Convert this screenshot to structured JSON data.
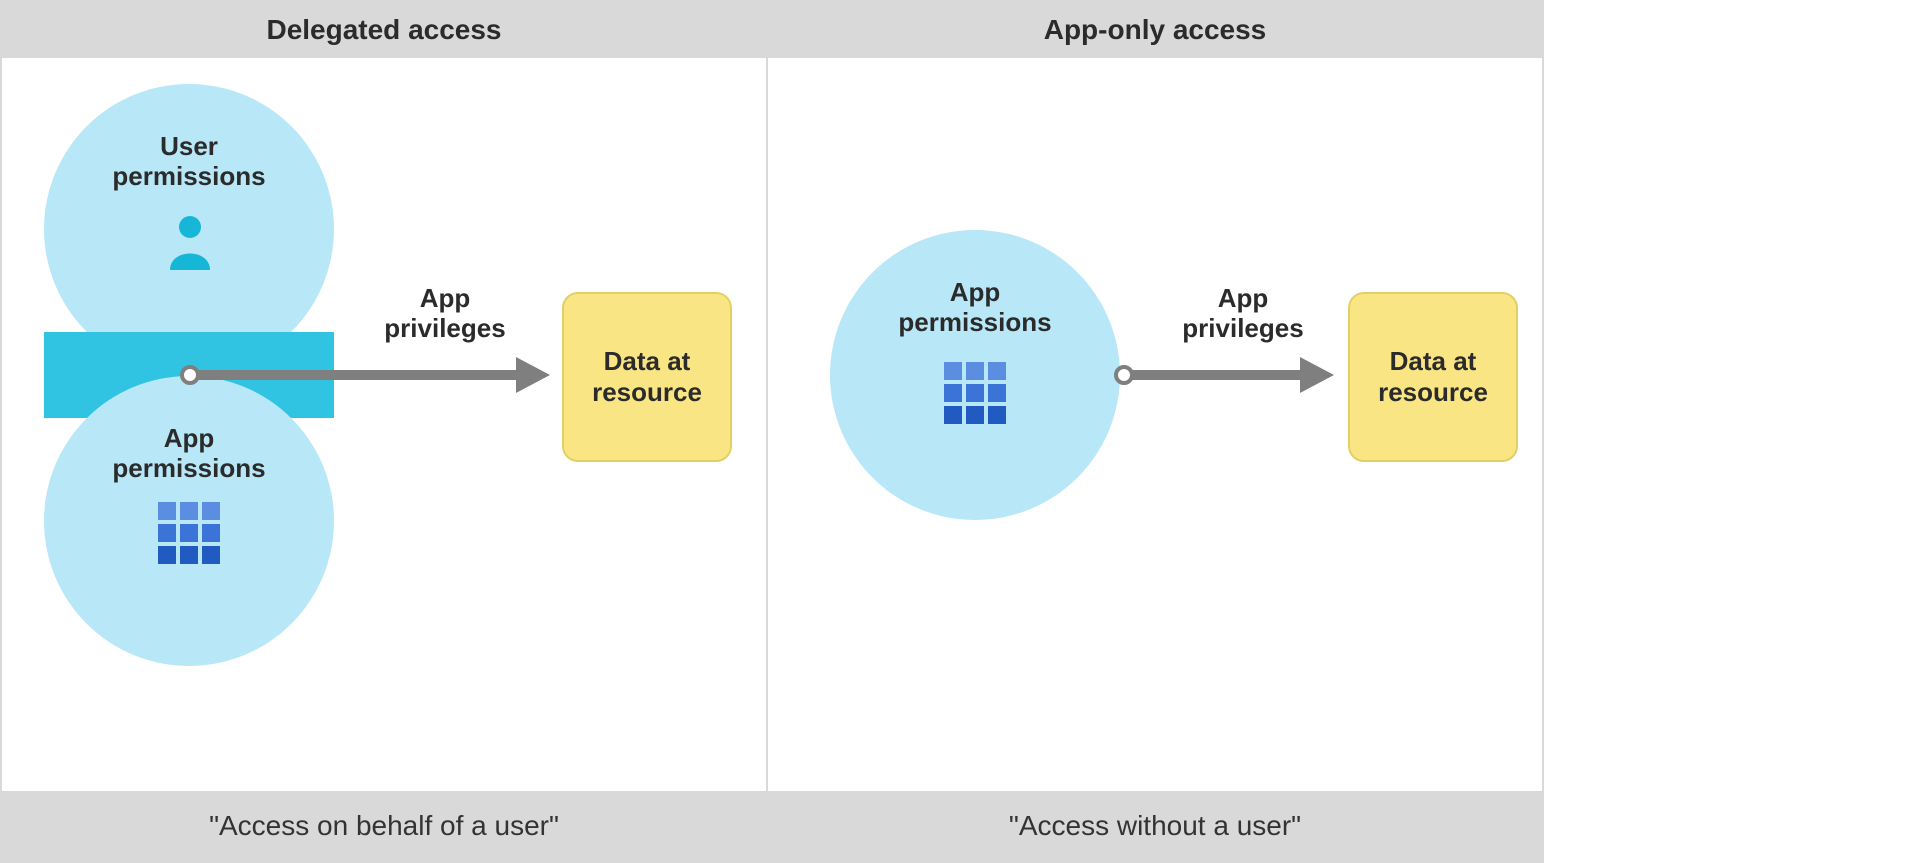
{
  "left": {
    "title": "Delegated access",
    "footer": "\"Access on behalf of a user\"",
    "user_perm_label": "User\npermissions",
    "app_perm_label": "App\npermissions",
    "arrow_label": "App\nprivileges",
    "resource_label": "Data at\nresource"
  },
  "right": {
    "title": "App-only access",
    "footer": "\"Access without a user\"",
    "app_perm_label": "App\npermissions",
    "arrow_label": "App\nprivileges",
    "resource_label": "Data at\nresource"
  },
  "icons": {
    "user": "user-icon",
    "grid": "grid-icon"
  },
  "colors": {
    "circle_fill": "#b8e7f8",
    "overlap_fill": "#31c4e2",
    "arrow": "#7f7f7f",
    "resource_fill": "#fae584",
    "header_fill": "#d9d9d9"
  }
}
